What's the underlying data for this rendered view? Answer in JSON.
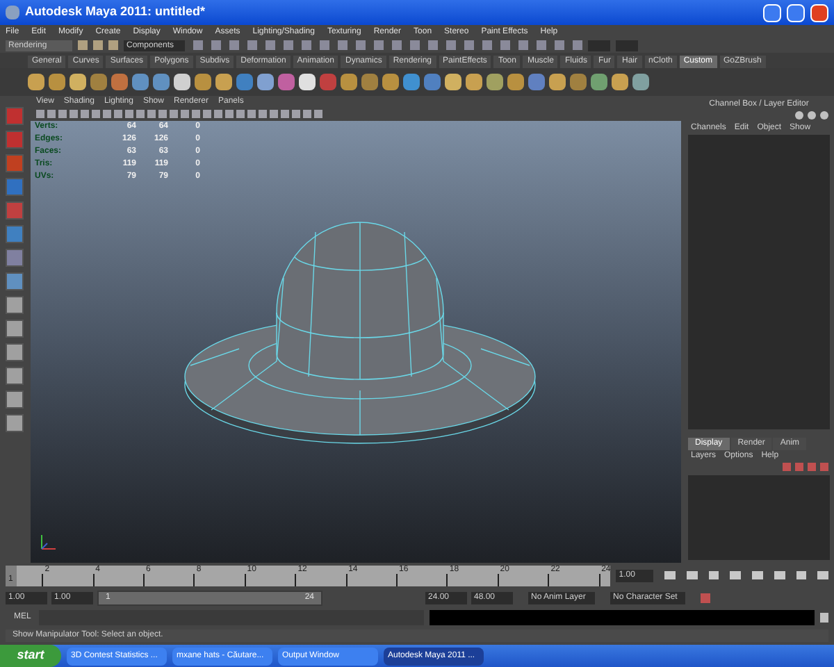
{
  "window": {
    "title": "Autodesk Maya 2011: untitled*"
  },
  "menu": [
    "File",
    "Edit",
    "Modify",
    "Create",
    "Display",
    "Window",
    "Assets",
    "Lighting/Shading",
    "Texturing",
    "Render",
    "Toon",
    "Stereo",
    "Paint Effects",
    "Help"
  ],
  "status_line": {
    "menu_set": "Rendering",
    "selection_mode": "Components"
  },
  "shelf_tabs": [
    {
      "label": "General",
      "selected": false
    },
    {
      "label": "Curves",
      "selected": false
    },
    {
      "label": "Surfaces",
      "selected": false
    },
    {
      "label": "Polygons",
      "selected": false
    },
    {
      "label": "Subdivs",
      "selected": false
    },
    {
      "label": "Deformation",
      "selected": false
    },
    {
      "label": "Animation",
      "selected": false
    },
    {
      "label": "Dynamics",
      "selected": false
    },
    {
      "label": "Rendering",
      "selected": false
    },
    {
      "label": "PaintEffects",
      "selected": false
    },
    {
      "label": "Toon",
      "selected": false
    },
    {
      "label": "Muscle",
      "selected": false
    },
    {
      "label": "Fluids",
      "selected": false
    },
    {
      "label": "Fur",
      "selected": false
    },
    {
      "label": "Hair",
      "selected": false
    },
    {
      "label": "nCloth",
      "selected": false
    },
    {
      "label": "Custom",
      "selected": true
    },
    {
      "label": "GoZBrush",
      "selected": false
    }
  ],
  "viewport": {
    "menu": [
      "View",
      "Shading",
      "Lighting",
      "Show",
      "Renderer",
      "Panels"
    ],
    "hud": [
      {
        "label": "Verts:",
        "values": [
          "64",
          "64",
          "0"
        ]
      },
      {
        "label": "Edges:",
        "values": [
          "126",
          "126",
          "0"
        ]
      },
      {
        "label": "Faces:",
        "values": [
          "63",
          "63",
          "0"
        ]
      },
      {
        "label": "Tris:",
        "values": [
          "119",
          "119",
          "0"
        ]
      },
      {
        "label": "UVs:",
        "values": [
          "79",
          "79",
          "0"
        ]
      }
    ]
  },
  "channel_box": {
    "title": "Channel Box / Layer Editor",
    "menu": [
      "Channels",
      "Edit",
      "Object",
      "Show"
    ]
  },
  "layer_editor": {
    "tabs": [
      {
        "label": "Display",
        "selected": true
      },
      {
        "label": "Render",
        "selected": false
      },
      {
        "label": "Anim",
        "selected": false
      }
    ],
    "menu": [
      "Layers",
      "Options",
      "Help"
    ]
  },
  "time_slider": {
    "start_label": "1",
    "ticks": [
      "2",
      "4",
      "6",
      "8",
      "10",
      "12",
      "14",
      "16",
      "18",
      "20",
      "22",
      "24"
    ],
    "current_time": "1.00",
    "level": 0
  },
  "range_slider": {
    "start_time": "1.00",
    "playback_start": "1.00",
    "range_start": "1",
    "range_end": "24",
    "level": 1,
    "playback_end": "24.00",
    "end_time": "48.00",
    "anim_layer": "No Anim Layer",
    "character_set": "No Character Set"
  },
  "command_line": {
    "label": "MEL"
  },
  "help_line": "Show Manipulator Tool: Select an object.",
  "taskbar": {
    "start": "start",
    "tasks": [
      {
        "label": "3D Contest Statistics ...",
        "selected": false
      },
      {
        "label": "mxane hats - Căutare...",
        "selected": false
      },
      {
        "label": "Output Window",
        "selected": false
      },
      {
        "label": "Autodesk Maya 2011 ...",
        "selected": true
      }
    ]
  }
}
